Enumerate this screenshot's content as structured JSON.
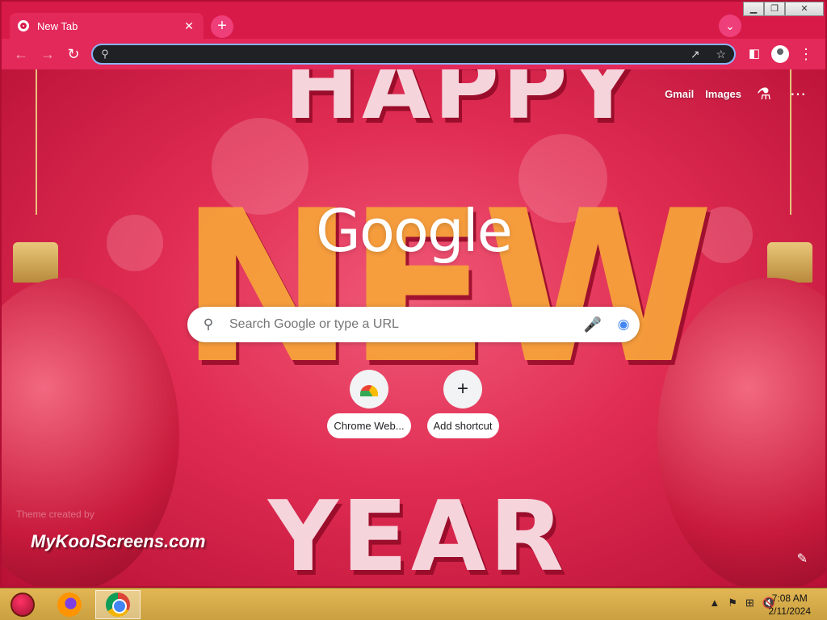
{
  "browser": {
    "tab": {
      "title": "New Tab",
      "close_glyph": "✕"
    },
    "new_tab_glyph": "+",
    "tab_search_glyph": "⌄",
    "caption": {
      "minimize": "▁",
      "maximize": "❐",
      "close": "✕"
    },
    "nav": {
      "back": "←",
      "forward": "→",
      "reload": "↻"
    },
    "omnibox": {
      "value": "",
      "placeholder": ""
    },
    "menu_glyph": "⋮"
  },
  "ntp": {
    "top_links": {
      "gmail": "Gmail",
      "images": "Images"
    },
    "logo_text": "Google",
    "search": {
      "placeholder": "Search Google or type a URL"
    },
    "shortcuts": [
      {
        "label": "Chrome Web...",
        "icon": "webstore-icon"
      },
      {
        "label": "Add shortcut",
        "icon": "plus-icon",
        "glyph": "+"
      }
    ],
    "theme_credit": "Theme created by",
    "site_watermark": "MyKoolScreens.com",
    "wallpaper_words": {
      "top": "HAPPY",
      "middle": "NEW",
      "bottom": "YEAR"
    }
  },
  "taskbar": {
    "clock": {
      "time": "7:08 AM",
      "date": "2/11/2024"
    },
    "tray_glyphs": {
      "expand": "▲",
      "flag": "⚑",
      "network": "⊞",
      "volume": "🔇"
    }
  },
  "colors": {
    "frame": "#d81a48",
    "toolbar": "#e3285a",
    "omnibox": "#202124",
    "taskbar": "#e2b654"
  }
}
